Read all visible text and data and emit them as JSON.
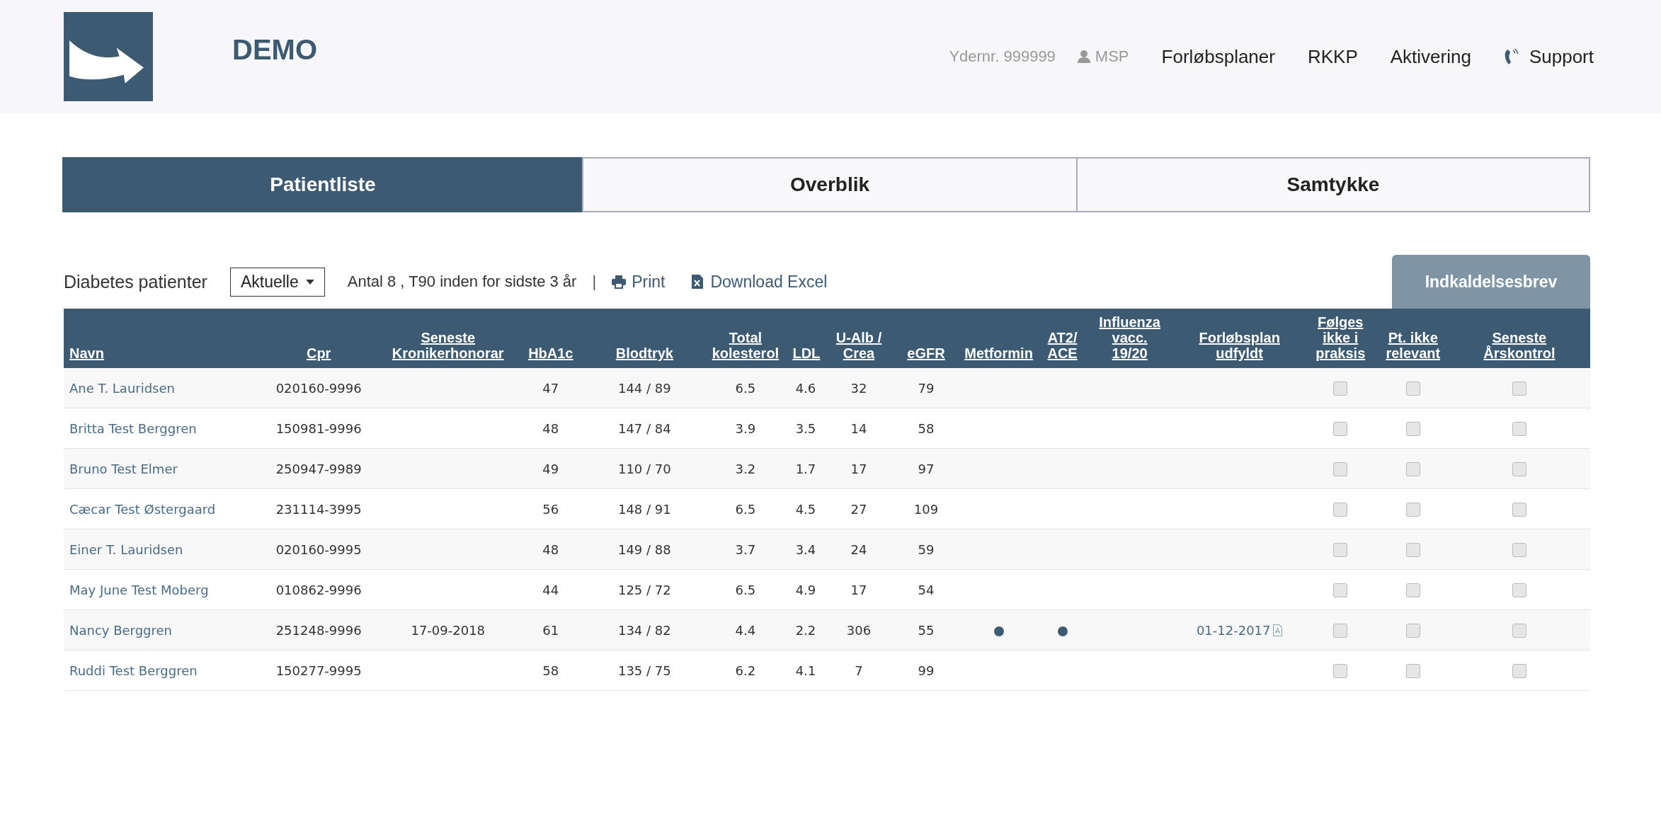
{
  "header": {
    "title": "DEMO",
    "provider": "Ydernr. 999999",
    "user": "MSP",
    "nav": [
      "Forløbsplaner",
      "RKKP",
      "Aktivering"
    ],
    "support": "Support"
  },
  "tabs": [
    {
      "label": "Patientliste",
      "selected": true
    },
    {
      "label": "Overblik",
      "selected": false
    },
    {
      "label": "Samtykke",
      "selected": false
    }
  ],
  "toolbar": {
    "label": "Diabetes patienter",
    "filter": "Aktuelle",
    "summary": "Antal 8 , T90 inden for sidste 3 år",
    "separator": "|",
    "print": "Print",
    "download": "Download Excel",
    "letter_button": "Indkaldelsesbrev"
  },
  "table": {
    "columns": [
      "Navn",
      "Cpr",
      "Seneste\nKronikerhonorar",
      "HbA1c",
      "Blodtryk",
      "Total\nkolesterol",
      "LDL",
      "U-Alb /\nCrea",
      "eGFR",
      "Metformin",
      "AT2/\nACE",
      "Influenza\nvacc.\n19/20",
      "Forløbsplan\nudfyldt",
      "Følges\nikke i\npraksis",
      "Pt. ikke\nrelevant",
      "Seneste\nÅrskontrol"
    ],
    "rows": [
      {
        "name": "Ane T. Lauridsen",
        "cpr": "020160-9996",
        "honorar": "",
        "hba1c": "47",
        "bp": "144 / 89",
        "chol": "6.5",
        "ldl": "4.6",
        "ualb": "32",
        "egfr": "79",
        "metformin": false,
        "at2": false,
        "plan": "",
        "not_followed": false,
        "not_relevant": false,
        "annual": false
      },
      {
        "name": "Britta Test Berggren",
        "cpr": "150981-9996",
        "honorar": "",
        "hba1c": "48",
        "bp": "147 / 84",
        "chol": "3.9",
        "ldl": "3.5",
        "ualb": "14",
        "egfr": "58",
        "metformin": false,
        "at2": false,
        "plan": "",
        "not_followed": false,
        "not_relevant": false,
        "annual": false
      },
      {
        "name": "Bruno Test Elmer",
        "cpr": "250947-9989",
        "honorar": "",
        "hba1c": "49",
        "bp": "110 / 70",
        "chol": "3.2",
        "ldl": "1.7",
        "ualb": "17",
        "egfr": "97",
        "metformin": false,
        "at2": false,
        "plan": "",
        "not_followed": false,
        "not_relevant": false,
        "annual": false
      },
      {
        "name": "Cæcar Test Østergaard",
        "cpr": "231114-3995",
        "honorar": "",
        "hba1c": "56",
        "bp": "148 / 91",
        "chol": "6.5",
        "ldl": "4.5",
        "ualb": "27",
        "egfr": "109",
        "metformin": false,
        "at2": false,
        "plan": "",
        "not_followed": false,
        "not_relevant": false,
        "annual": false
      },
      {
        "name": "Einer T. Lauridsen",
        "cpr": "020160-9995",
        "honorar": "",
        "hba1c": "48",
        "bp": "149 / 88",
        "chol": "3.7",
        "ldl": "3.4",
        "ualb": "24",
        "egfr": "59",
        "metformin": false,
        "at2": false,
        "plan": "",
        "not_followed": false,
        "not_relevant": false,
        "annual": false
      },
      {
        "name": "May June Test Moberg",
        "cpr": "010862-9996",
        "honorar": "",
        "hba1c": "44",
        "bp": "125 / 72",
        "chol": "6.5",
        "ldl": "4.9",
        "ualb": "17",
        "egfr": "54",
        "metformin": false,
        "at2": false,
        "plan": "",
        "not_followed": false,
        "not_relevant": false,
        "annual": false
      },
      {
        "name": "Nancy Berggren",
        "cpr": "251248-9996",
        "honorar": "17-09-2018",
        "hba1c": "61",
        "bp": "134 / 82",
        "chol": "4.4",
        "ldl": "2.2",
        "ualb": "306",
        "egfr": "55",
        "metformin": true,
        "at2": true,
        "plan": "01-12-2017",
        "not_followed": false,
        "not_relevant": false,
        "annual": false
      },
      {
        "name": "Ruddi Test Berggren",
        "cpr": "150277-9995",
        "honorar": "",
        "hba1c": "58",
        "bp": "135 / 75",
        "chol": "6.2",
        "ldl": "4.1",
        "ualb": "7",
        "egfr": "99",
        "metformin": false,
        "at2": false,
        "plan": "",
        "not_followed": false,
        "not_relevant": false,
        "annual": false
      }
    ]
  }
}
